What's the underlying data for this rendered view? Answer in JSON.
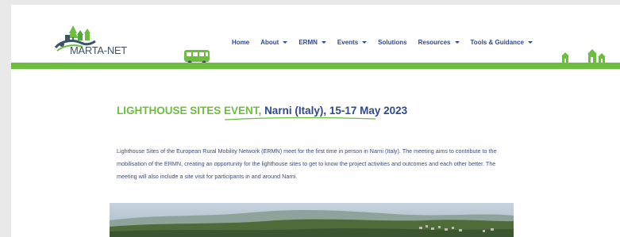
{
  "logo": {
    "text": "MARTA-NET"
  },
  "nav": {
    "items": [
      {
        "label": "Home",
        "dropdown": false
      },
      {
        "label": "About",
        "dropdown": true
      },
      {
        "label": "ERMN",
        "dropdown": true
      },
      {
        "label": "Events",
        "dropdown": true
      },
      {
        "label": "Solutions",
        "dropdown": false
      },
      {
        "label": "Resources",
        "dropdown": true
      },
      {
        "label": "Tools & Guidance",
        "dropdown": true
      }
    ]
  },
  "event": {
    "title_prefix": "LIGHTHOUSE SITES EVENT",
    "title_suffix": "Narni (Italy), 15-17 May 2023",
    "description": "Lighthouse Sites of the European Rural Mobility Network (ERMN) meet for the first time in person in Narni (Italy). The meeting aims to contribute to the mobilisation of the ERMN, creating an opportunity for the lighthouse sites to get to know the project activities and outcomes and each other better. The meeting will also include a site visit for participants in and around Narni."
  },
  "colors": {
    "brand_green": "#6cbf3c",
    "nav_blue": "#2e4a8b",
    "text_blue": "#3b4a7a"
  }
}
